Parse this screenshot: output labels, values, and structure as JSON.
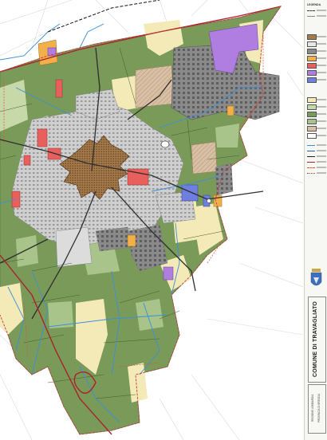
{
  "legend": {
    "title": "LEGENDA"
  },
  "panel": {
    "comune": "COMUNE DI TRAVAGLIATO",
    "regione": "REGIONE LOMBARDIA",
    "provincia": "PROVINCIA DI BRESCIA"
  },
  "colors": {
    "agricultural": "#7a9a5a",
    "agricultural_light": "#a9c48a",
    "historic_centre": "#a57a4a",
    "residential": "#cfcfcf",
    "industrial": "#8a8a8a",
    "services": "#e8605e",
    "productive_new": "#f2b04a",
    "commercial": "#b07ee0",
    "public_blue": "#6f7fe0",
    "park_cream": "#f3eab8",
    "tan_hatched": "#d8c0a6",
    "boundary": "#b8252c",
    "road": "#3a3a3a",
    "canal": "#3a8fd8"
  }
}
